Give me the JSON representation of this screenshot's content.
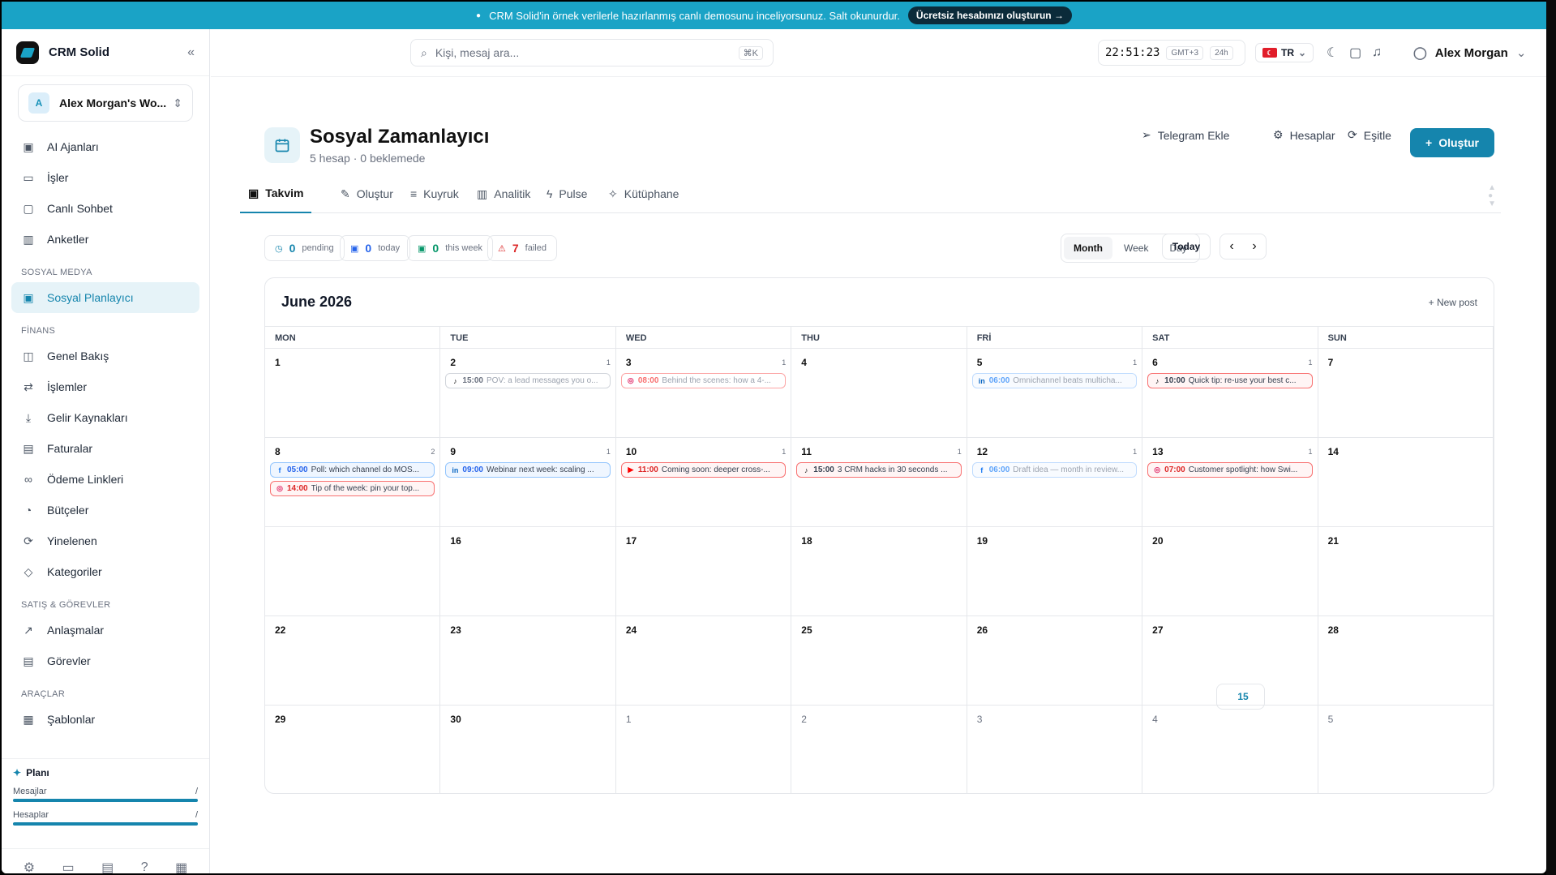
{
  "banner": {
    "text": "CRM Solid'in örnek verilerle hazırlanmış canlı demosunu inceliyorsunuz. Salt okunurdur.",
    "cta": "Ücretsiz hesabınızı oluşturun →"
  },
  "brand": {
    "name": "CRM Solid",
    "workspace": "Alex Morgan's Wo...",
    "workspace_initial": "A"
  },
  "sidebar": {
    "top": [
      {
        "label": "AI Ajanları",
        "icon": "cpu-icon"
      },
      {
        "label": "İşler",
        "icon": "briefcase-icon"
      },
      {
        "label": "Canlı Sohbet",
        "icon": "chat-icon"
      },
      {
        "label": "Anketler",
        "icon": "chart-icon"
      }
    ],
    "sections": [
      {
        "title": "SOSYAL MEDYA",
        "items": [
          {
            "label": "Sosyal Planlayıcı",
            "icon": "calendar-icon",
            "active": true
          }
        ]
      },
      {
        "title": "FİNANS",
        "items": [
          {
            "label": "Genel Bakış",
            "icon": "cash-icon"
          },
          {
            "label": "İşlemler",
            "icon": "swap-icon"
          },
          {
            "label": "Gelir Kaynakları",
            "icon": "download-icon"
          },
          {
            "label": "Faturalar",
            "icon": "receipt-icon"
          },
          {
            "label": "Ödeme Linkleri",
            "icon": "link-icon"
          },
          {
            "label": "Bütçeler",
            "icon": "piggy-icon"
          },
          {
            "label": "Yinelenen",
            "icon": "repeat-icon"
          },
          {
            "label": "Kategoriler",
            "icon": "tag-icon"
          }
        ]
      },
      {
        "title": "SATIŞ & GÖREVLER",
        "items": [
          {
            "label": "Anlaşmalar",
            "icon": "trend-icon"
          },
          {
            "label": "Görevler",
            "icon": "clipboard-icon"
          }
        ]
      },
      {
        "title": "ARAÇLAR",
        "items": [
          {
            "label": "Şablonlar",
            "icon": "template-icon"
          }
        ]
      }
    ],
    "plan": {
      "title": "Planı",
      "rows": [
        {
          "label": "Mesajlar",
          "value": "/"
        },
        {
          "label": "Hesaplar",
          "value": "/"
        }
      ]
    }
  },
  "topbar": {
    "search_placeholder": "Kişi, mesaj ara...",
    "search_kbd": "⌘K",
    "time": "22:51:23",
    "tz": "GMT+3",
    "format": "24h",
    "lang": "TR",
    "user": "Alex Morgan"
  },
  "page": {
    "title": "Sosyal Zamanlayıcı",
    "subtitle": "5 hesap · 0 beklemede",
    "actions": [
      "Telegram Ekle",
      "Hesaplar",
      "Eşitle"
    ],
    "create": "Oluştur"
  },
  "tabs": [
    "Takvim",
    "Oluştur",
    "Kuyruk",
    "Analitik",
    "Pulse",
    "Kütüphane"
  ],
  "stats": [
    {
      "n": "0",
      "label": "pending",
      "color": "#1585ad"
    },
    {
      "n": "0",
      "label": "today",
      "color": "#2563eb"
    },
    {
      "n": "0",
      "label": "this week",
      "color": "#059669"
    },
    {
      "n": "7",
      "label": "failed",
      "color": "#dc2626"
    }
  ],
  "views": [
    "Month",
    "Week",
    "Day"
  ],
  "today_label": "Today",
  "calendar": {
    "title": "June 2026",
    "new_post": "New post",
    "dow": [
      "MON",
      "TUE",
      "WED",
      "THU",
      "FRİ",
      "SAT",
      "SUN"
    ],
    "weeks": [
      [
        {
          "d": "1"
        },
        {
          "d": "2",
          "c": "1",
          "ev": [
            {
              "p": "tiktok",
              "t": "15:00",
              "x": "POV: a lead messages you o...",
              "s": "draft"
            }
          ]
        },
        {
          "d": "3",
          "c": "1",
          "ev": [
            {
              "p": "instagram",
              "t": "08:00",
              "x": "Behind the scenes: how a 4-...",
              "s": "pend"
            }
          ]
        },
        {
          "d": "4"
        },
        {
          "d": "5",
          "c": "1",
          "ev": [
            {
              "p": "linkedin",
              "t": "06:00",
              "x": "Omnichannel beats multicha...",
              "s": "schedlight"
            }
          ]
        },
        {
          "d": "6",
          "c": "1",
          "ev": [
            {
              "p": "tiktok",
              "t": "10:00",
              "x": "Quick tip: re-use your best c...",
              "s": "fail"
            }
          ]
        },
        {
          "d": "7"
        }
      ],
      [
        {
          "d": "8",
          "c": "2",
          "ev": [
            {
              "p": "facebook",
              "t": "05:00",
              "x": "Poll: which channel do MOS...",
              "s": "sched"
            },
            {
              "p": "instagram",
              "t": "14:00",
              "x": "Tip of the week: pin your top...",
              "s": "fail"
            }
          ]
        },
        {
          "d": "9",
          "c": "1",
          "ev": [
            {
              "p": "linkedin",
              "t": "09:00",
              "x": "Webinar next week: scaling ...",
              "s": "sched"
            }
          ]
        },
        {
          "d": "10",
          "c": "1",
          "ev": [
            {
              "p": "youtube",
              "t": "11:00",
              "x": "Coming soon: deeper cross-...",
              "s": "fail"
            }
          ]
        },
        {
          "d": "11",
          "c": "1",
          "ev": [
            {
              "p": "tiktok",
              "t": "15:00",
              "x": "3 CRM hacks in 30 seconds ...",
              "s": "fail"
            }
          ]
        },
        {
          "d": "12",
          "c": "1",
          "ev": [
            {
              "p": "facebook",
              "t": "06:00",
              "x": "Draft idea — month in review...",
              "s": "schedlight"
            }
          ]
        },
        {
          "d": "13",
          "c": "1",
          "ev": [
            {
              "p": "instagram",
              "t": "07:00",
              "x": "Customer spotlight: how Swi...",
              "s": "fail"
            }
          ]
        },
        {
          "d": "14"
        }
      ],
      [
        {
          "d": "15",
          "today": true
        },
        {
          "d": "16"
        },
        {
          "d": "17"
        },
        {
          "d": "18"
        },
        {
          "d": "19"
        },
        {
          "d": "20"
        },
        {
          "d": "21"
        }
      ],
      [
        {
          "d": "22"
        },
        {
          "d": "23"
        },
        {
          "d": "24"
        },
        {
          "d": "25"
        },
        {
          "d": "26"
        },
        {
          "d": "27"
        },
        {
          "d": "28"
        }
      ],
      [
        {
          "d": "29"
        },
        {
          "d": "30"
        },
        {
          "d": "1",
          "muted": true
        },
        {
          "d": "2",
          "muted": true
        },
        {
          "d": "3",
          "muted": true
        },
        {
          "d": "4",
          "muted": true
        },
        {
          "d": "5",
          "muted": true
        }
      ]
    ]
  },
  "colors": {
    "accent": "#1585ad",
    "banner": "#1aa3c6"
  }
}
